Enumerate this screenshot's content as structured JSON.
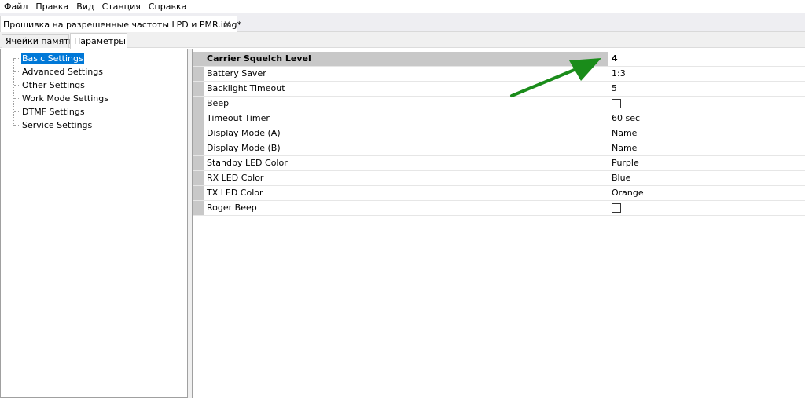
{
  "menu": [
    "Файл",
    "Правка",
    "Вид",
    "Станция",
    "Справка"
  ],
  "document_tab": {
    "title": "Прошивка на разрешенные частоты LPD и PMR.img*",
    "close_glyph": "✕"
  },
  "inner_tabs": [
    {
      "label": "Ячейки памяти",
      "active": false
    },
    {
      "label": "Параметры",
      "active": true
    }
  ],
  "tree": {
    "items": [
      {
        "label": "Basic Settings",
        "selected": true
      },
      {
        "label": "Advanced Settings",
        "selected": false
      },
      {
        "label": "Other Settings",
        "selected": false
      },
      {
        "label": "Work Mode Settings",
        "selected": false
      },
      {
        "label": "DTMF Settings",
        "selected": false
      },
      {
        "label": "Service Settings",
        "selected": false
      }
    ]
  },
  "properties": [
    {
      "name": "Carrier Squelch Level",
      "value": "4",
      "type": "text",
      "selected": true
    },
    {
      "name": "Battery Saver",
      "value": "1:3",
      "type": "text"
    },
    {
      "name": "Backlight Timeout",
      "value": "5",
      "type": "text"
    },
    {
      "name": "Beep",
      "value": "",
      "type": "checkbox",
      "checked": false
    },
    {
      "name": "Timeout Timer",
      "value": "60 sec",
      "type": "text"
    },
    {
      "name": "Display Mode (A)",
      "value": "Name",
      "type": "text"
    },
    {
      "name": "Display Mode (B)",
      "value": "Name",
      "type": "text"
    },
    {
      "name": "Standby LED Color",
      "value": "Purple",
      "type": "text"
    },
    {
      "name": "RX LED Color",
      "value": "Blue",
      "type": "text"
    },
    {
      "name": "TX LED Color",
      "value": "Orange",
      "type": "text"
    },
    {
      "name": "Roger Beep",
      "value": "",
      "type": "checkbox",
      "checked": false
    }
  ],
  "annotation": {
    "arrow_color": "#1a8c1a",
    "points_to": "Carrier Squelch Level value"
  },
  "colors": {
    "selection_blue": "#0078d7",
    "gutter_gray": "#c8c8c8"
  }
}
